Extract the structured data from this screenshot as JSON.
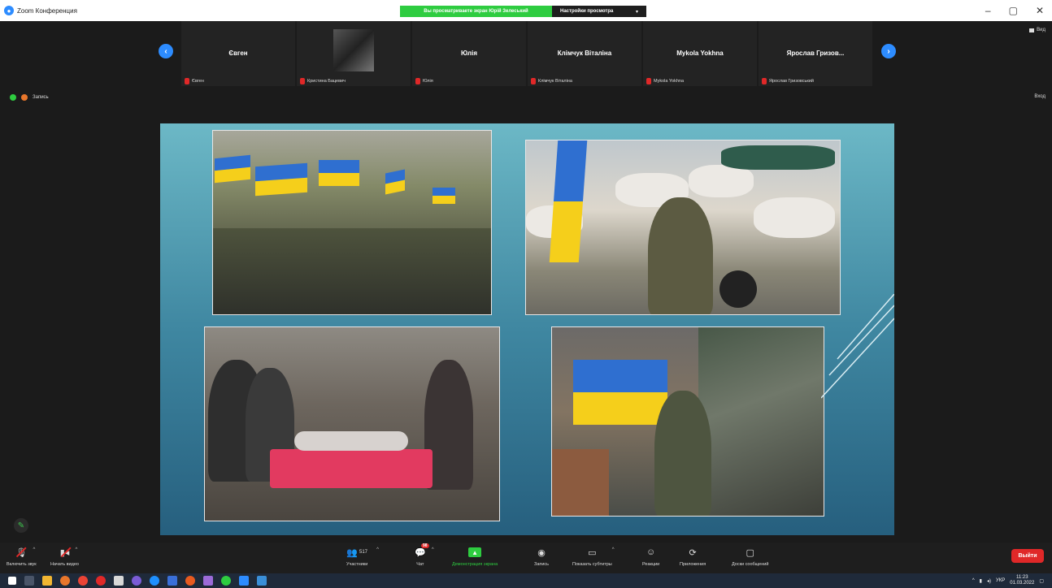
{
  "window": {
    "title": "Zoom Конференция",
    "share_banner": "Вы просматриваете экран Юрій Зелеський",
    "view_options": "Настройки просмотра",
    "controls": {
      "minimize": "–",
      "maximize": "▢",
      "close": "✕"
    }
  },
  "meeting": {
    "view_label": "Вид",
    "exit_fullscreen": "Вход",
    "recording_label": "Запись",
    "participants_tiles": [
      {
        "name": "Євген",
        "label": "Євген",
        "avatar": false
      },
      {
        "name": "",
        "label": "Кристина Бацевич",
        "avatar": true
      },
      {
        "name": "Юлія",
        "label": "Юлія",
        "avatar": false
      },
      {
        "name": "Клімчук Віталіна",
        "label": "Клімчук Віталіна",
        "avatar": false
      },
      {
        "name": "Mykola Yokhna",
        "label": "Mykola Yokhna",
        "avatar": false
      },
      {
        "name": "Ярослав Гризов...",
        "label": "Ярослав Гризовський",
        "avatar": false
      }
    ],
    "nav_left": "‹",
    "nav_right": "›"
  },
  "toolbar": {
    "unmute": "Включить звук",
    "start_video": "Начать видео",
    "participants": "Участники",
    "participants_count": "517",
    "chat": "Чат",
    "chat_badge": "98",
    "share_screen": "Демонстрация экрана",
    "record": "Запись",
    "captions": "Показать субтитры",
    "reactions": "Реакции",
    "apps": "Приложения",
    "whiteboards": "Доски сообщений",
    "leave": "Выйти"
  },
  "taskbar": {
    "lang": "УКР",
    "time": "11:23",
    "date": "01.03.2022"
  },
  "colors": {
    "zoom_blue": "#2d8cff",
    "share_green": "#2ecc40",
    "leave_red": "#e02828",
    "slide_teal": "#4a94ab"
  }
}
